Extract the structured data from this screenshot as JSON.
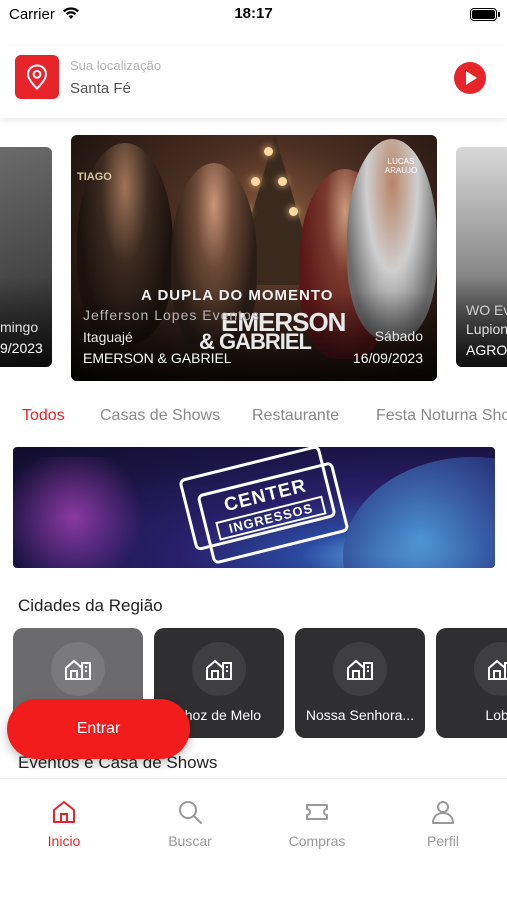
{
  "status_bar": {
    "carrier": "Carrier",
    "time": "18:17"
  },
  "location": {
    "label": "Sua localização",
    "city": "Santa Fé"
  },
  "carousel": {
    "left_card": {
      "line1": "mingo",
      "line2": "9/2023"
    },
    "main_card": {
      "organizer": "Jefferson Lopes Eventos",
      "city": "Itaguajé",
      "name": "EMERSON & GABRIEL",
      "weekday": "Sábado",
      "date": "16/09/2023",
      "poster_headline": "A DUPLA DO MOMENTO",
      "poster_name_1": "EMERSON",
      "poster_name_2": "& GABRIEL",
      "poster_brand": "TIAGO",
      "poster_tag": "LUCAS ARAUJO"
    },
    "right_card": {
      "line1": "WO Ev",
      "line2": "Lupion",
      "line3": "AGRON"
    }
  },
  "tabs": [
    {
      "label": "Todos",
      "active": true
    },
    {
      "label": "Casas de Shows",
      "active": false
    },
    {
      "label": "Restaurante",
      "active": false
    },
    {
      "label": "Festa Noturna Sho",
      "active": false
    }
  ],
  "banner": {
    "line1": "CENTER",
    "line2": "INGRESSOS"
  },
  "cities_section": {
    "title": "Cidades da Região"
  },
  "cities": [
    {
      "name": ""
    },
    {
      "name": "nhoz de Melo"
    },
    {
      "name": "Nossa Senhora..."
    },
    {
      "name": "Loba"
    }
  ],
  "events_section": {
    "title": "Eventos e Casa de Shows"
  },
  "entrar_button": {
    "label": "Entrar"
  },
  "bottom_nav": [
    {
      "label": "Inicio",
      "icon": "home-icon",
      "active": true
    },
    {
      "label": "Buscar",
      "icon": "search-icon",
      "active": false
    },
    {
      "label": "Compras",
      "icon": "ticket-icon",
      "active": false
    },
    {
      "label": "Perfil",
      "icon": "user-icon",
      "active": false
    }
  ],
  "colors": {
    "accent": "#e8242b",
    "city_card": "#2f2f31",
    "inactive": "#9a9a9a"
  }
}
